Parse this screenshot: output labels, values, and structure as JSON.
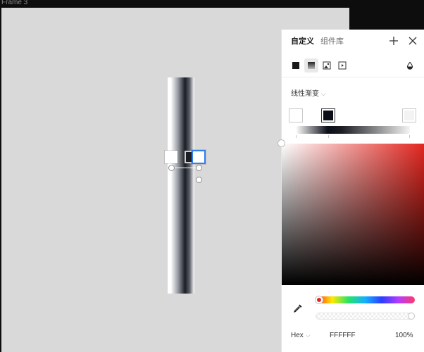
{
  "canvas": {
    "frame_label": "Frame 3",
    "frame_background": "#d9d9d9"
  },
  "panel": {
    "tabs": [
      {
        "label": "自定义",
        "active": true
      },
      {
        "label": "组件库",
        "active": false
      }
    ],
    "fill_types": [
      "solid-fill-icon",
      "linear-gradient-icon",
      "image-fill-icon",
      "video-fill-icon",
      "opacity-drop-icon"
    ],
    "gradient_type": {
      "label": "线性渐变"
    },
    "gradient_stops": [
      "#ffffff",
      "#0b0e19",
      "#f3f3f3"
    ],
    "color": {
      "hue": "#e3261f",
      "format": "Hex",
      "hex": "FFFFFF",
      "alpha": "100%"
    },
    "accent": "#2f80ed"
  }
}
